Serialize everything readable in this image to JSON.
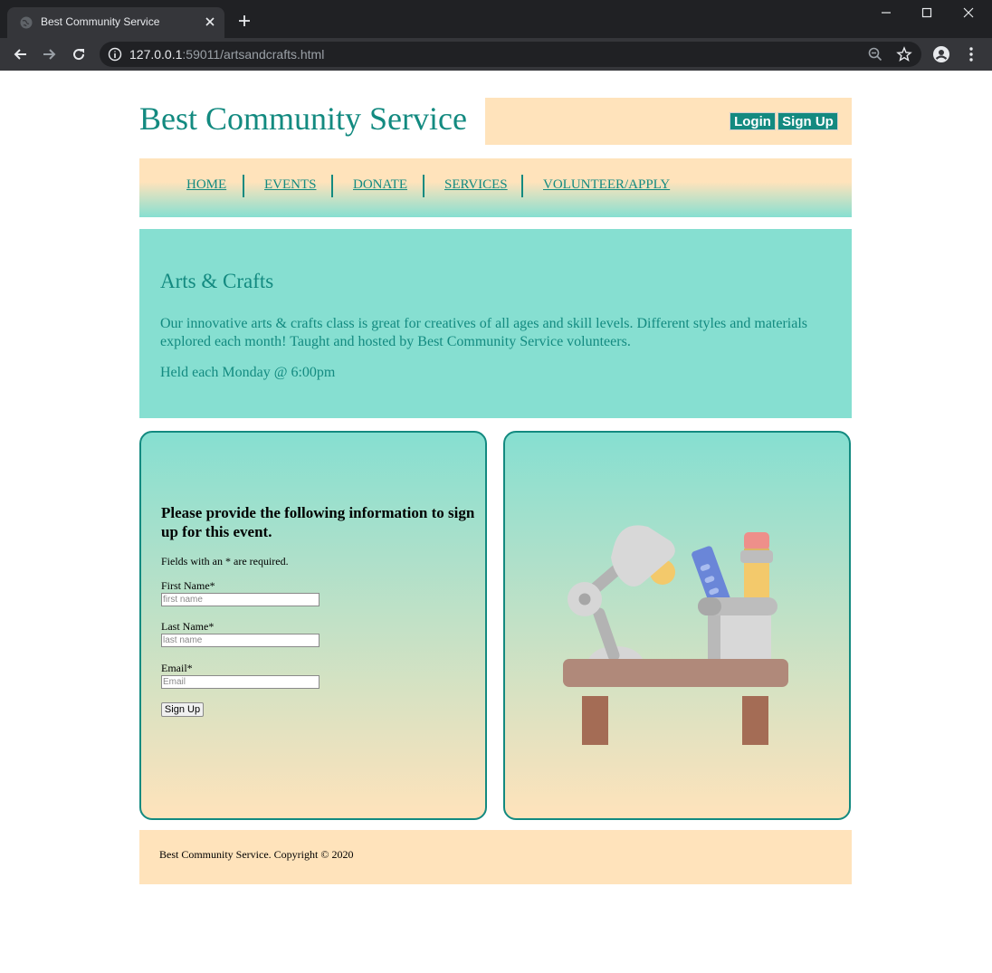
{
  "browser": {
    "tab_title": "Best Community Service",
    "url_host": "127.0.0.1",
    "url_rest": ":59011/artsandcrafts.html",
    "icons": [
      "globe-icon",
      "close-icon",
      "plus-icon",
      "minimize-icon",
      "maximize-icon",
      "window-close-icon",
      "back-arrow-icon",
      "forward-arrow-icon",
      "reload-icon",
      "info-icon",
      "zoom-icon",
      "star-icon",
      "profile-icon",
      "kebab-menu-icon"
    ]
  },
  "header": {
    "site_title": "Best Community Service",
    "login_label": "Login",
    "signup_label": "Sign Up"
  },
  "nav": {
    "items": [
      {
        "label": "HOME"
      },
      {
        "label": "EVENTS"
      },
      {
        "label": "DONATE"
      },
      {
        "label": "SERVICES"
      },
      {
        "label": "VOLUNTEER/APPLY"
      }
    ]
  },
  "event": {
    "title": "Arts & Crafts",
    "description": "Our innovative arts & crafts class is great for creatives of all ages and skill levels. Different styles and materials explored each month! Taught and hosted by Best Community Service volunteers.",
    "schedule": "Held each Monday @ 6:00pm"
  },
  "form": {
    "heading": "Please provide the following information to sign up for this event.",
    "required_note": "Fields with an * are required.",
    "first_name_label": "First Name*",
    "first_name_placeholder": "first name",
    "last_name_label": "Last Name*",
    "last_name_placeholder": "last name",
    "email_label": "Email*",
    "email_placeholder": "Email",
    "submit_label": "Sign Up"
  },
  "illustration": {
    "icon": "desk-lamp-pencil-cup-illustration"
  },
  "footer": {
    "text": "Best Community Service. Copyright © 2020"
  },
  "colors": {
    "brand_teal": "#138a80",
    "peach": "#ffe3bb",
    "aqua": "#86dfd1",
    "chrome_dark": "#202124",
    "chrome_tab": "#35363a"
  }
}
